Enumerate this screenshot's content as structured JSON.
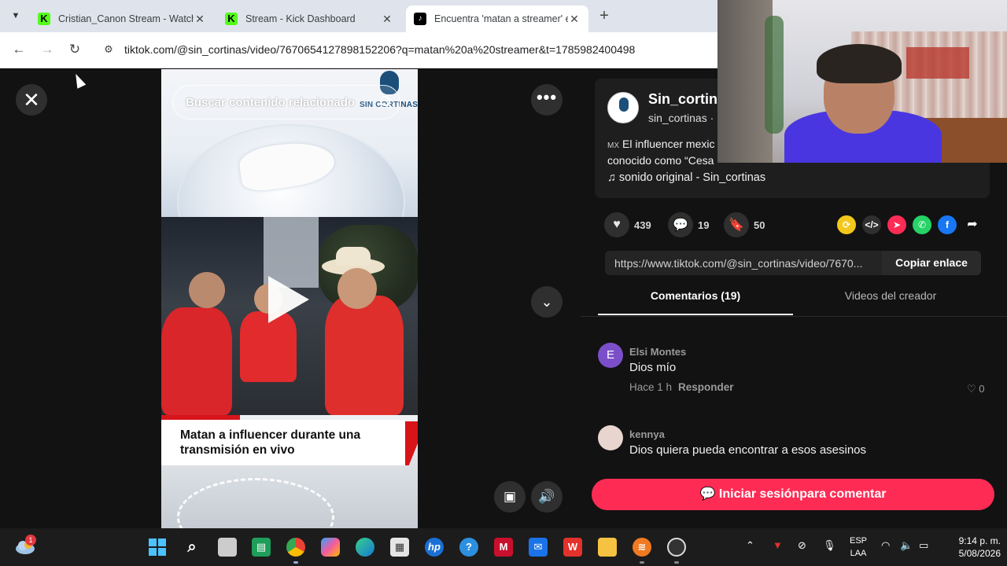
{
  "browser": {
    "tabs": [
      {
        "title": "Cristian_Canon Stream - Watch",
        "favicon": "kick-icon",
        "active": false
      },
      {
        "title": "Stream - Kick Dashboard",
        "favicon": "kick-icon",
        "active": false
      },
      {
        "title": "Encuentra 'matan a streamer' en",
        "favicon": "tiktok-icon",
        "active": true
      }
    ],
    "url": "tiktok.com/@sin_cortinas/video/7670654127898152206?q=matan%20a%20streamer&t=1785982400498"
  },
  "video": {
    "search_related_placeholder": "Buscar contenido relacionado",
    "logo_text": "SIN CORTINAS",
    "caption": "Matan a influencer durante una transmisión en vivo"
  },
  "author": {
    "display_name": "Sin_cortina",
    "handle": "sin_cortinas · ",
    "description_flag": "MX",
    "description": "El influencer mexic conocido como “Cesa",
    "sound": "sonido original - Sin_cortinas"
  },
  "actions": {
    "likes": "439",
    "comments": "19",
    "saves": "50"
  },
  "share": {
    "link": "https://www.tiktok.com/@sin_cortinas/video/7670...",
    "copy_label": "Copiar enlace"
  },
  "tabs": {
    "comments": "Comentarios (19)",
    "creator_videos": "Videos del creador"
  },
  "comments": [
    {
      "avatar_letter": "E",
      "user": "Elsi Montes",
      "text": "Dios mío",
      "time": "Hace 1 h",
      "reply": "Responder",
      "likes": "0",
      "avatar_color": "#7b4fc9"
    },
    {
      "avatar_letter": "",
      "user": "kennya",
      "text": "Dios quiera pueda encontrar a esos asesinos",
      "time": "",
      "reply": "",
      "likes": "",
      "avatar_color": "#e8d5cf"
    }
  ],
  "login_cta": "Iniciar sesiónpara comentar",
  "colors": {
    "accent": "#fe2c55",
    "background": "#121212"
  },
  "taskbar": {
    "weather_badge": "1",
    "language_top": "ESP",
    "language_bottom": "LAA",
    "time": "9:14 p. m.",
    "date": "5/08/2026"
  }
}
